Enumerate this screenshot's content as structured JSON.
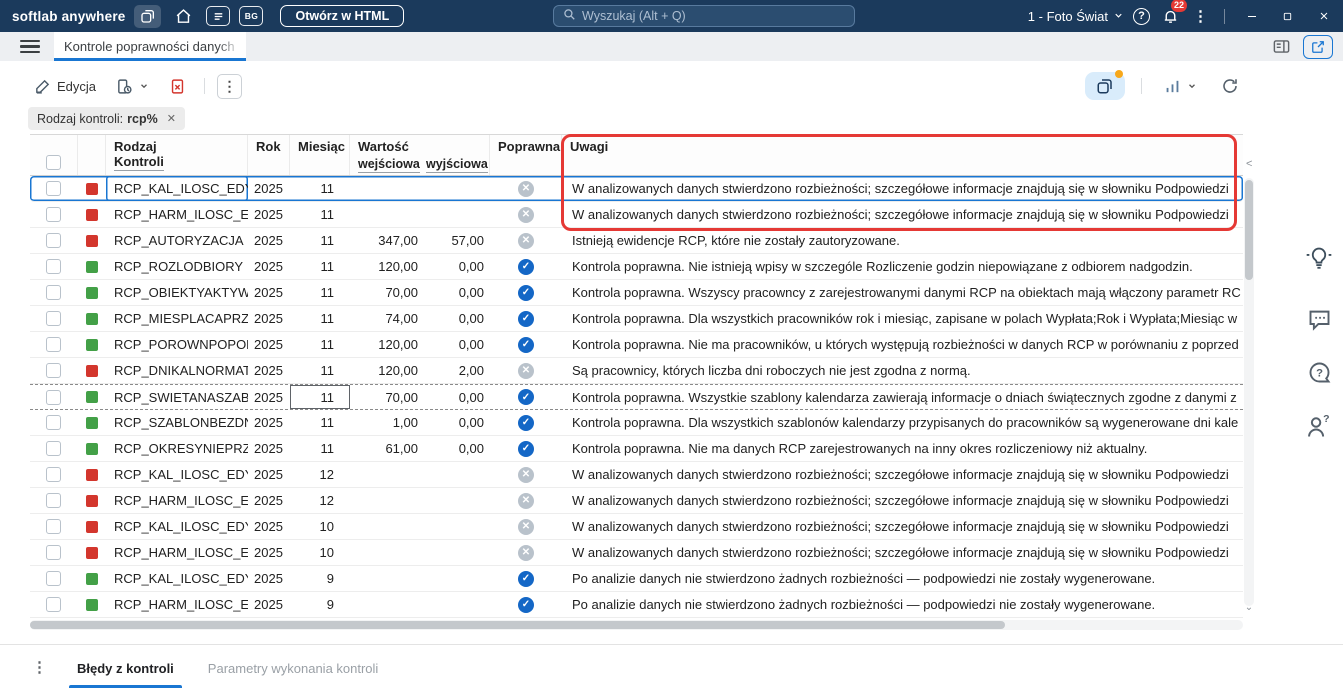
{
  "colors": {
    "topbar_bg": "#1b3a5c",
    "accent_blue": "#1976d2",
    "status_red": "#d3362d",
    "status_green": "#43a047",
    "check_blue": "#1467c6",
    "cross_gray": "#b9c2cb",
    "annotation_red": "#e53935",
    "badge_red": "#e53935",
    "filter_dot_orange": "#f7a81b"
  },
  "icons": {
    "kebab": "⋮",
    "check": "✓",
    "cross": "✕",
    "chip_close": "✕",
    "question": "?",
    "chevron_left": "<",
    "chevron_down": "⌄"
  },
  "topbar": {
    "brand": "softlab anywhere",
    "bg_label": "BG",
    "open_html_button": "Otwórz w HTML",
    "search_placeholder": "Wyszukaj (Alt + Q)",
    "profile_label": "1 - Foto Świat",
    "notification_count": "22"
  },
  "tabbar": {
    "active_tab": "Kontrole poprawności danych"
  },
  "toolbar": {
    "edit_label": "Edycja"
  },
  "filter_chip": {
    "label": "Rodzaj kontroli:",
    "value": "rcp%"
  },
  "table": {
    "headers": {
      "rodzaj_line1": "Rodzaj",
      "rodzaj_line2": "Kontroli",
      "rok": "Rok",
      "miesiac": "Miesiąc",
      "wartosc": "Wartość",
      "wejsciowa": "wejściowa",
      "wyjsciowa": "wyjściowa",
      "poprawna": "Poprawna",
      "uwagi": "Uwagi"
    },
    "rows": [
      {
        "status": "red",
        "name": "RCP_KAL_ILOSC_EDYCJI",
        "rok": "2025",
        "miesiac": "11",
        "wejsciowa": "",
        "wyjsciowa": "",
        "poprawna": false,
        "uwagi": "W analizowanych danych stwierdzono rozbieżności; szczegółowe informacje znajdują się w słowniku Podpowiedzi",
        "selected": true,
        "focus": "kontrola"
      },
      {
        "status": "red",
        "name": "RCP_HARM_ILOSC_EDYCJ",
        "rok": "2025",
        "miesiac": "11",
        "wejsciowa": "",
        "wyjsciowa": "",
        "poprawna": false,
        "uwagi": "W analizowanych danych stwierdzono rozbieżności; szczegółowe informacje znajdują się w słowniku Podpowiedzi"
      },
      {
        "status": "red",
        "name": "RCP_AUTORYZACJA",
        "rok": "2025",
        "miesiac": "11",
        "wejsciowa": "347,00",
        "wyjsciowa": "57,00",
        "poprawna": false,
        "uwagi": "Istnieją ewidencje RCP, które nie zostały zautoryzowane."
      },
      {
        "status": "green",
        "name": "RCP_ROZLODBIORY",
        "rok": "2025",
        "miesiac": "11",
        "wejsciowa": "120,00",
        "wyjsciowa": "0,00",
        "poprawna": true,
        "uwagi": "Kontrola poprawna. Nie istnieją wpisy w szczególe Rozliczenie godzin niepowiązane z odbiorem nadgodzin."
      },
      {
        "status": "green",
        "name": "RCP_OBIEKTYAKTYWNE",
        "rok": "2025",
        "miesiac": "11",
        "wejsciowa": "70,00",
        "wyjsciowa": "0,00",
        "poprawna": true,
        "uwagi": "Kontrola poprawna. Wszyscy pracowncy z zarejestrowanymi danymi RCP na obiektach mają włączony parametr RC"
      },
      {
        "status": "green",
        "name": "RCP_MIESPLACAPRZESUN",
        "rok": "2025",
        "miesiac": "11",
        "wejsciowa": "74,00",
        "wyjsciowa": "0,00",
        "poprawna": true,
        "uwagi": "Kontrola poprawna. Dla wszystkich pracowników rok i miesiąc, zapisane w polach Wypłata;Rok i Wypłata;Miesiąc w"
      },
      {
        "status": "green",
        "name": "RCP_POROWNPOPOKRESO",
        "rok": "2025",
        "miesiac": "11",
        "wejsciowa": "120,00",
        "wyjsciowa": "0,00",
        "poprawna": true,
        "uwagi": "Kontrola poprawna. Nie ma pracowników, u których występują rozbieżności w danych RCP w porównaniu z poprzed"
      },
      {
        "status": "red",
        "name": "RCP_DNIKALNORMATYWN",
        "rok": "2025",
        "miesiac": "11",
        "wejsciowa": "120,00",
        "wyjsciowa": "2,00",
        "poprawna": false,
        "uwagi": "Są pracownicy, których liczba dni roboczych nie jest zgodna z normą."
      },
      {
        "status": "green",
        "name": "RCP_SWIETANASZABLON",
        "rok": "2025",
        "miesiac": "11",
        "wejsciowa": "70,00",
        "wyjsciowa": "0,00",
        "poprawna": true,
        "uwagi": "Kontrola poprawna. Wszystkie szablony kalendarza zawierają informacje o dniach świątecznych zgodne z danymi z",
        "dashed": true,
        "focus": "miesiac"
      },
      {
        "status": "green",
        "name": "RCP_SZABLONBEZDNI",
        "rok": "2025",
        "miesiac": "11",
        "wejsciowa": "1,00",
        "wyjsciowa": "0,00",
        "poprawna": true,
        "uwagi": "Kontrola poprawna. Dla wszystkich szablonów kalendarzy przypisanych do pracowników są wygenerowane dni kale"
      },
      {
        "status": "green",
        "name": "RCP_OKRESYNIEPRZYPIS",
        "rok": "2025",
        "miesiac": "11",
        "wejsciowa": "61,00",
        "wyjsciowa": "0,00",
        "poprawna": true,
        "uwagi": "Kontrola poprawna. Nie ma danych RCP zarejestrowanych na inny okres rozliczeniowy niż aktualny."
      },
      {
        "status": "red",
        "name": "RCP_KAL_ILOSC_EDYCJI",
        "rok": "2025",
        "miesiac": "12",
        "wejsciowa": "",
        "wyjsciowa": "",
        "poprawna": false,
        "uwagi": "W analizowanych danych stwierdzono rozbieżności; szczegółowe informacje znajdują się w słowniku Podpowiedzi"
      },
      {
        "status": "red",
        "name": "RCP_HARM_ILOSC_EDYCJ",
        "rok": "2025",
        "miesiac": "12",
        "wejsciowa": "",
        "wyjsciowa": "",
        "poprawna": false,
        "uwagi": "W analizowanych danych stwierdzono rozbieżności; szczegółowe informacje znajdują się w słowniku Podpowiedzi"
      },
      {
        "status": "red",
        "name": "RCP_KAL_ILOSC_EDYCJI",
        "rok": "2025",
        "miesiac": "10",
        "wejsciowa": "",
        "wyjsciowa": "",
        "poprawna": false,
        "uwagi": "W analizowanych danych stwierdzono rozbieżności; szczegółowe informacje znajdują się w słowniku Podpowiedzi"
      },
      {
        "status": "red",
        "name": "RCP_HARM_ILOSC_EDYCJ",
        "rok": "2025",
        "miesiac": "10",
        "wejsciowa": "",
        "wyjsciowa": "",
        "poprawna": false,
        "uwagi": "W analizowanych danych stwierdzono rozbieżności; szczegółowe informacje znajdują się w słowniku Podpowiedzi"
      },
      {
        "status": "green",
        "name": "RCP_KAL_ILOSC_EDYCJI",
        "rok": "2025",
        "miesiac": "9",
        "wejsciowa": "",
        "wyjsciowa": "",
        "poprawna": true,
        "uwagi": "Po analizie danych nie stwierdzono żadnych rozbieżności — podpowiedzi nie zostały wygenerowane."
      },
      {
        "status": "green",
        "name": "RCP_HARM_ILOSC_EDYCJ",
        "rok": "2025",
        "miesiac": "9",
        "wejsciowa": "",
        "wyjsciowa": "",
        "poprawna": true,
        "uwagi": "Po analizie danych nie stwierdzono żadnych rozbieżności — podpowiedzi nie zostały wygenerowane."
      }
    ]
  },
  "bottom_tabs": {
    "active": "Błędy z kontroli",
    "inactive": "Parametry wykonania kontroli"
  }
}
